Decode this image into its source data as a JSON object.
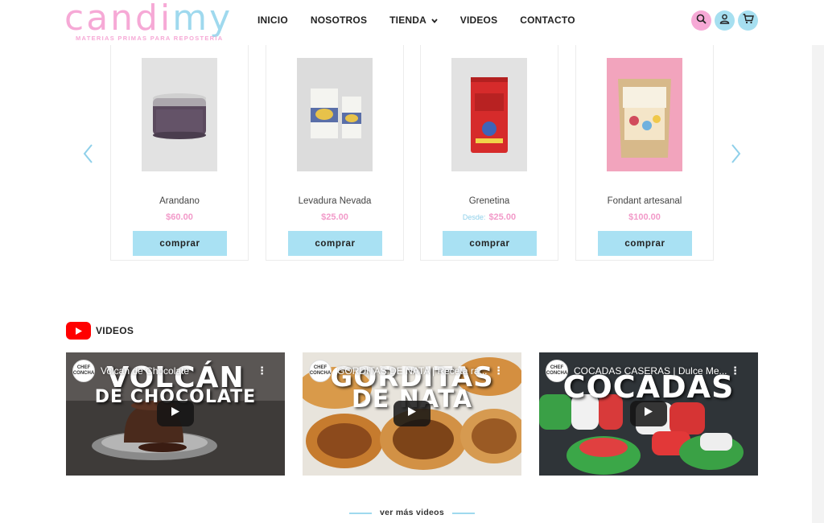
{
  "brand": {
    "logo_part1": "candi",
    "logo_part2": "my",
    "tagline": "MATERIAS PRIMAS PARA REPOSTERÍA",
    "pink": "#f6a9d6",
    "blue": "#a6dff0"
  },
  "nav": {
    "items": [
      {
        "label": "INICIO"
      },
      {
        "label": "NOSOTROS"
      },
      {
        "label": "TIENDA"
      },
      {
        "label": "VIDEOS"
      },
      {
        "label": "CONTACTO"
      }
    ]
  },
  "header_icons": [
    "search-icon",
    "user-icon",
    "cart-icon"
  ],
  "products": [
    {
      "name": "Arandano",
      "price_prefix": "",
      "price": "$60.00",
      "button": "comprar"
    },
    {
      "name": "Levadura Nevada",
      "price_prefix": "",
      "price": "$25.00",
      "button": "comprar"
    },
    {
      "name": "Grenetina",
      "price_prefix": "Desde:",
      "price": "$25.00",
      "button": "comprar"
    },
    {
      "name": "Fondant artesanal",
      "price_prefix": "",
      "price": "$100.00",
      "button": "comprar"
    }
  ],
  "videos_section": {
    "title": "VIDEOS",
    "videos": [
      {
        "title": "Volcan de Chocolate",
        "overlay_line1": "VOLCÁN",
        "overlay_line2": "DE CHOCOLATE",
        "channel": "CHEF CONCHA"
      },
      {
        "title": "GORDITAS DE NATA | Receta ra...",
        "overlay_line1": "GORDITAS",
        "overlay_line2": "DE NATA",
        "channel": "CHEF CONCHA"
      },
      {
        "title": "COCADAS CASERAS | Dulce Me...",
        "overlay_line1": "COCADAS",
        "overlay_line2": "",
        "channel": "CHEF CONCHA"
      }
    ],
    "more_link": "ver más videos"
  }
}
